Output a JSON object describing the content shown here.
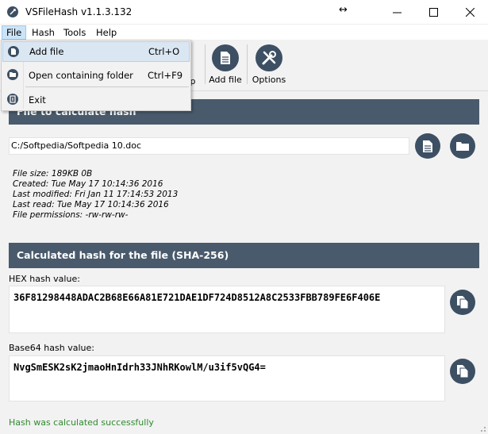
{
  "window": {
    "title": "VSFileHash v1.1.3.132"
  },
  "menu": {
    "items": [
      "File",
      "Hash",
      "Tools",
      "Help"
    ]
  },
  "file_menu": {
    "items": [
      {
        "label": "Add file",
        "shortcut": "Ctrl+O"
      },
      {
        "label": "Open containing folder",
        "shortcut": "Ctrl+F9"
      },
      {
        "label": "Exit",
        "shortcut": ""
      }
    ]
  },
  "toolbar": {
    "partial_label": "p",
    "add_file_label": "Add file",
    "options_label": "Options"
  },
  "file_section": {
    "header": "File to calculate hash",
    "path": "C:/Softpedia/Softpedia 10.doc",
    "info": {
      "size": "File size: 189KB 0B",
      "created": "Created: Tue May 17 10:14:36 2016",
      "modified": "Last modified: Fri Jan 11 17:14:53 2013",
      "read": "Last read: Tue May 17 10:14:36 2016",
      "permissions": "File permissions: -rw-rw-rw-"
    }
  },
  "hash_section": {
    "header": "Calculated hash for the file (SHA-256)",
    "hex_label": "HEX hash value:",
    "hex_value": "36F81298448ADAC2B68E66A81E721DAE1DF724D8512A8C2533FBB789FE6F406E",
    "b64_label": "Base64 hash value:",
    "b64_value": "NvgSmESK2sK2jmaoHnIdrh33JNhRKowlM/u3if5vQG4="
  },
  "status": {
    "text": "Hash was calculated successfully"
  },
  "colors": {
    "accent": "#495a6c",
    "button": "#3d4f63",
    "status": "#2e8b2e"
  }
}
